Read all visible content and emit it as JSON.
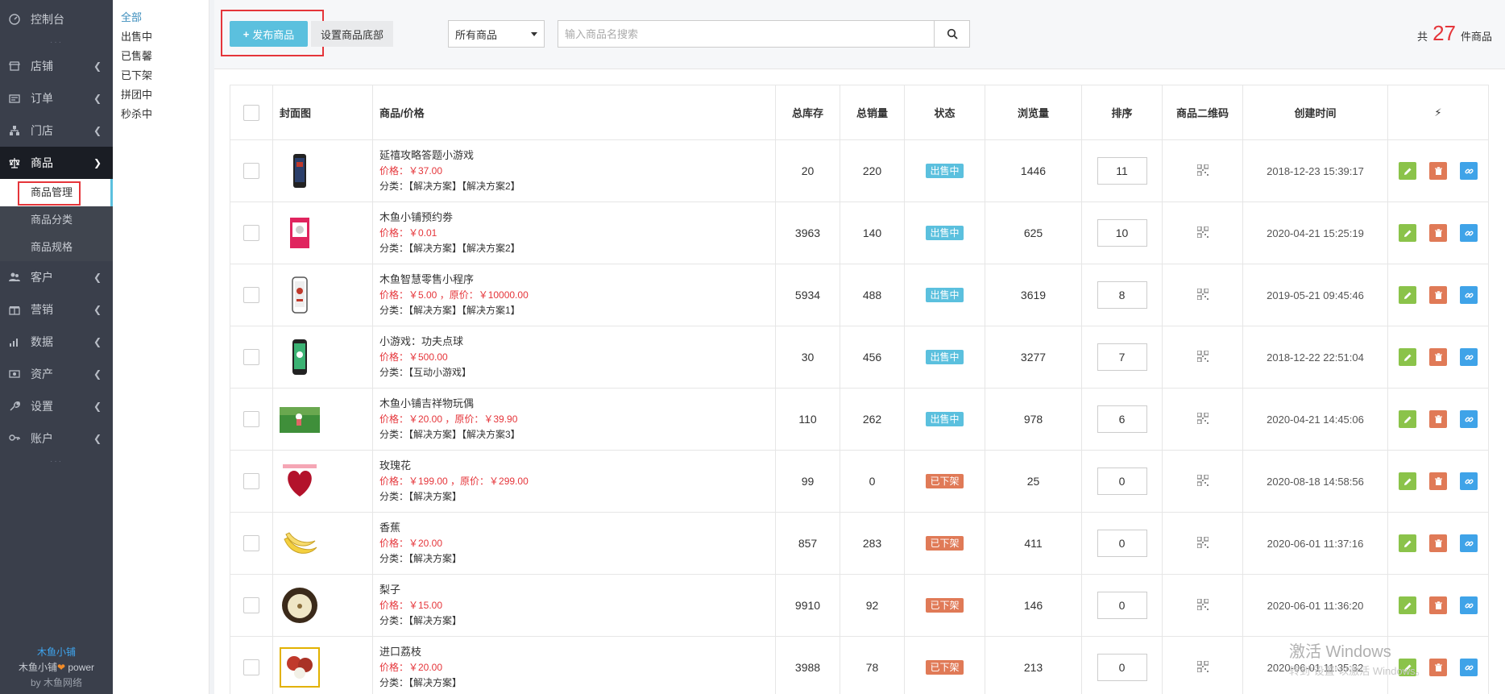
{
  "nav": {
    "items": [
      {
        "label": "控制台",
        "icon": "dashboard-icon"
      },
      {
        "label": "店铺",
        "icon": "shop-icon"
      },
      {
        "label": "订单",
        "icon": "order-icon"
      },
      {
        "label": "门店",
        "icon": "store-icon"
      },
      {
        "label": "商品",
        "icon": "scale-icon"
      },
      {
        "label": "客户",
        "icon": "users-icon"
      },
      {
        "label": "营销",
        "icon": "marketing-icon"
      },
      {
        "label": "数据",
        "icon": "data-icon"
      },
      {
        "label": "资产",
        "icon": "asset-icon"
      },
      {
        "label": "设置",
        "icon": "wrench-icon"
      },
      {
        "label": "账户",
        "icon": "account-icon"
      }
    ],
    "sub": [
      "商品管理",
      "商品分类",
      "商品规格"
    ],
    "brand_name": "木鱼小铺",
    "brand_power_prefix": "木鱼小铺",
    "brand_power_suffix": "power",
    "brand_by": "by 木鱼网络"
  },
  "filter": [
    "全部",
    "出售中",
    "已售馨",
    "已下架",
    "拼团中",
    "秒杀中"
  ],
  "toolbar": {
    "publish_label": "发布商品",
    "footer_label": "设置商品底部",
    "select_value": "所有商品",
    "search_placeholder": "输入商品名搜索",
    "total_prefix": "共",
    "total_count": "27",
    "total_suffix": "件商品"
  },
  "table": {
    "headers": [
      "封面图",
      "商品/价格",
      "总库存",
      "总销量",
      "状态",
      "浏览量",
      "排序",
      "商品二维码",
      "创建时间"
    ],
    "rows": [
      {
        "name": "延禧攻略答题小游戏",
        "price": "价格：￥37.00",
        "category": "分类：【解决方案】【解决方案2】",
        "stock": "20",
        "sales": "220",
        "status": "出售中",
        "views": "1446",
        "sort": "11",
        "created": "2018-12-23 15:39:17",
        "thumb": "phone-game"
      },
      {
        "name": "木鱼小铺预约劵",
        "price": "价格：￥0.01",
        "category": "分类：【解决方案】【解决方案2】",
        "stock": "3963",
        "sales": "140",
        "status": "出售中",
        "views": "625",
        "sort": "10",
        "created": "2020-04-21 15:25:19",
        "thumb": "coupon"
      },
      {
        "name": "木鱼智慧零售小程序",
        "price": "价格：￥5.00 ，原价：￥10000.00",
        "category": "分类：【解决方案】【解决方案1】",
        "stock": "5934",
        "sales": "488",
        "status": "出售中",
        "views": "3619",
        "sort": "8",
        "created": "2019-05-21 09:45:46",
        "thumb": "phone-retail"
      },
      {
        "name": "小游戏：功夫点球",
        "price": "价格：￥500.00",
        "category": "分类：【互动小游戏】",
        "stock": "30",
        "sales": "456",
        "status": "出售中",
        "views": "3277",
        "sort": "7",
        "created": "2018-12-22 22:51:04",
        "thumb": "phone-green"
      },
      {
        "name": "木鱼小铺吉祥物玩偶",
        "price": "价格：￥20.00 ，原价：￥39.90",
        "category": "分类：【解决方案】【解决方案3】",
        "stock": "110",
        "sales": "262",
        "status": "出售中",
        "views": "978",
        "sort": "6",
        "created": "2020-04-21 14:45:06",
        "thumb": "grass"
      },
      {
        "name": "玫瑰花",
        "price": "价格：￥199.00 ，原价：￥299.00",
        "category": "分类：【解决方案】",
        "stock": "99",
        "sales": "0",
        "status": "已下架",
        "views": "25",
        "sort": "0",
        "created": "2020-08-18 14:58:56",
        "thumb": "rose"
      },
      {
        "name": "香蕉",
        "price": "价格：￥20.00",
        "category": "分类：【解决方案】",
        "stock": "857",
        "sales": "283",
        "status": "已下架",
        "views": "411",
        "sort": "0",
        "created": "2020-06-01 11:37:16",
        "thumb": "banana"
      },
      {
        "name": "梨子",
        "price": "价格：￥15.00",
        "category": "分类：【解决方案】",
        "stock": "9910",
        "sales": "92",
        "status": "已下架",
        "views": "146",
        "sort": "0",
        "created": "2020-06-01 11:36:20",
        "thumb": "pear"
      },
      {
        "name": "进口荔枝",
        "price": "价格：￥20.00",
        "category": "分类：【解决方案】",
        "stock": "3988",
        "sales": "78",
        "status": "已下架",
        "views": "213",
        "sort": "0",
        "created": "2020-06-01 11:35:32",
        "thumb": "lychee"
      }
    ]
  },
  "colors": {
    "on_sale": "#5bc0de",
    "off_shelf": "#e07a57",
    "accent": "#5bc0de",
    "highlight": "#e5353a"
  },
  "watermark": {
    "line1": "激活 Windows",
    "line2": "转到\"设置\"以激活 Windows。"
  }
}
